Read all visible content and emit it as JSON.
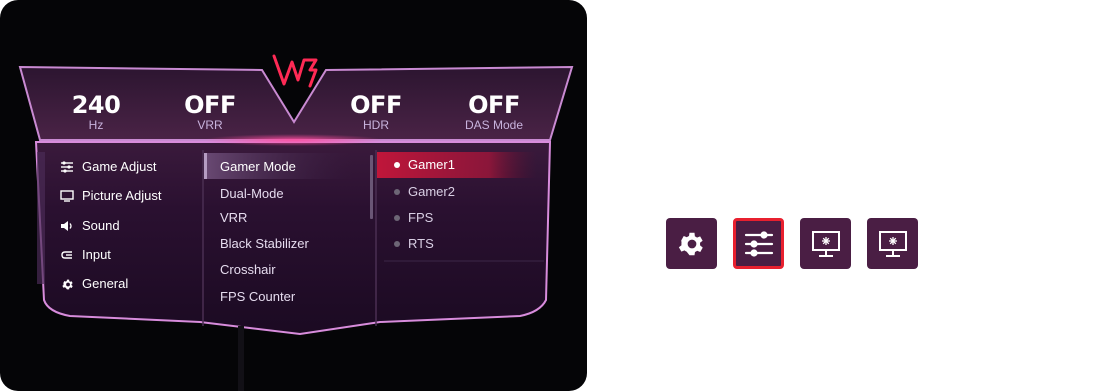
{
  "status_bar": {
    "refresh": {
      "value": "240",
      "label": "Hz"
    },
    "vrr": {
      "value": "OFF",
      "label": "VRR"
    },
    "hdr": {
      "value": "OFF",
      "label": "HDR"
    },
    "das": {
      "value": "OFF",
      "label": "DAS Mode"
    }
  },
  "categories": [
    {
      "label": "Game Adjust",
      "icon": "sliders-icon"
    },
    {
      "label": "Picture Adjust",
      "icon": "monitor-icon"
    },
    {
      "label": "Sound",
      "icon": "speaker-icon"
    },
    {
      "label": "Input",
      "icon": "input-icon"
    },
    {
      "label": "General",
      "icon": "gear-icon"
    }
  ],
  "submenu": [
    {
      "label": "Gamer Mode"
    },
    {
      "label": "Dual-Mode"
    },
    {
      "label": "VRR"
    },
    {
      "label": "Black Stabilizer"
    },
    {
      "label": "Crosshair"
    },
    {
      "label": "FPS Counter"
    }
  ],
  "options": [
    {
      "label": "Gamer1",
      "selected": true
    },
    {
      "label": "Gamer2",
      "selected": false
    },
    {
      "label": "FPS",
      "selected": false
    },
    {
      "label": "RTS",
      "selected": false
    }
  ],
  "quick_buttons": [
    {
      "icon": "gear-icon",
      "active": false
    },
    {
      "icon": "sliders-icon",
      "active": true
    },
    {
      "icon": "monitor-brightness-icon",
      "active": false
    },
    {
      "icon": "monitor-brightness-icon",
      "active": false
    }
  ],
  "colors": {
    "accent_red": "#e8202f",
    "panel_purple": "#4a1e44",
    "neon_pink": "#e070c8"
  }
}
